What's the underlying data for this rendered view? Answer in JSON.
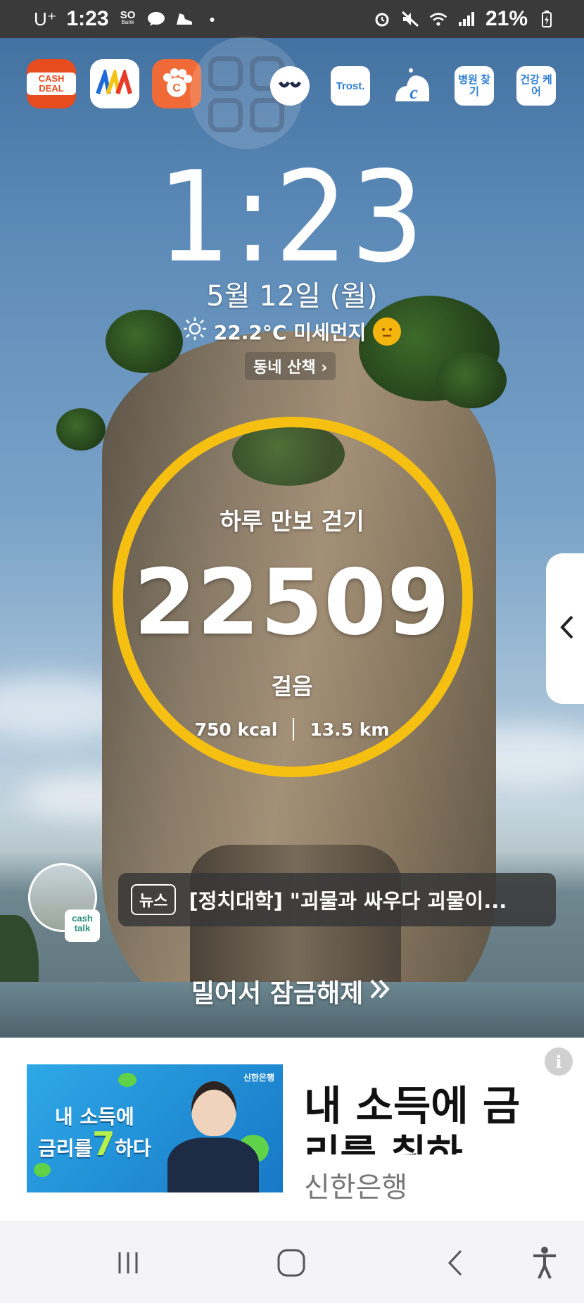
{
  "status_bar": {
    "carrier": "U⁺",
    "time": "1:23",
    "bank_icon_label": "Bank",
    "battery": "21%"
  },
  "apps": {
    "cash_deal": "CASH DEAL",
    "trost": "Trost.",
    "hospital": "병원 찾기",
    "health_care": "건강 케어"
  },
  "lockscreen": {
    "clock": "1:23",
    "date": "5월 12일 (월)",
    "weather": "22.2°C 미세먼지",
    "walk_link": "동네 산책 ›"
  },
  "pedometer": {
    "title": "하루 만보 걷기",
    "steps": "22509",
    "unit": "걸음",
    "kcal": "750 kcal",
    "distance": "13.5 km",
    "ring_color": "#f6c012"
  },
  "news": {
    "tag": "뉴스",
    "headline": "[정치대학] \"괴물과 싸우다 괴물이...",
    "badge": "cash talk"
  },
  "unlock": {
    "label": "밀어서 잠금해제"
  },
  "ad": {
    "image_logo": "신한은행",
    "image_slogan_line1": "내 소득에",
    "image_slogan_line2_a": "금리를",
    "image_slogan_line2_num": "7",
    "image_slogan_line2_b": "하다",
    "headline": "내 소득에 금",
    "subline": "리를 취하",
    "brand": "신한은행",
    "info": "i"
  }
}
